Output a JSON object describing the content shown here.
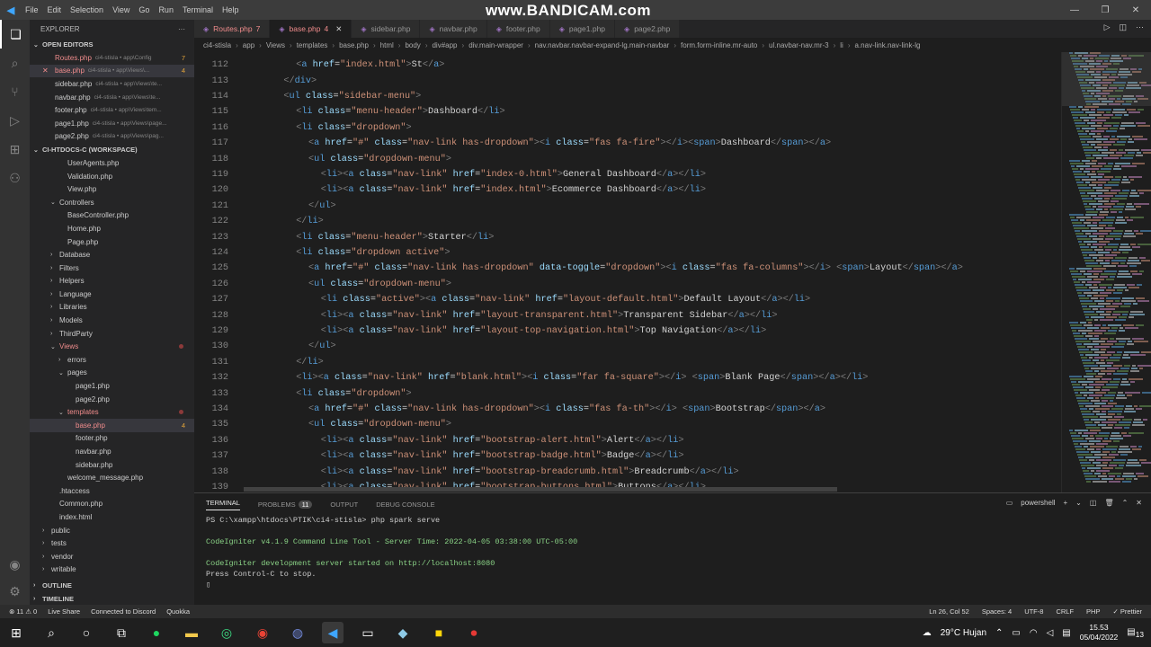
{
  "watermark": "www.BANDICAM.com",
  "menu": [
    "File",
    "Edit",
    "Selection",
    "View",
    "Go",
    "Run",
    "Terminal",
    "Help"
  ],
  "sidebar": {
    "title": "EXPLORER",
    "open_editors_label": "OPEN EDITORS",
    "open_editors": [
      {
        "name": "Routes.php",
        "desc": "ci4-stisla • app\\Config",
        "badge": "7",
        "state": "err"
      },
      {
        "name": "base.php",
        "desc": "ci4-stisla • app\\Views\\...",
        "badge": "4",
        "state": "err",
        "selected": true
      },
      {
        "name": "sidebar.php",
        "desc": "ci4-stisla • app\\Views\\te..."
      },
      {
        "name": "navbar.php",
        "desc": "ci4-stisla • app\\Views\\te..."
      },
      {
        "name": "footer.php",
        "desc": "ci4-stisla • app\\Views\\tem..."
      },
      {
        "name": "page1.php",
        "desc": "ci4-stisla • app\\Views\\page..."
      },
      {
        "name": "page2.php",
        "desc": "ci4-stisla • app\\Views\\pag..."
      }
    ],
    "workspace_label": "CI-HTDOCS-C (WORKSPACE)",
    "tree": [
      {
        "name": "UserAgents.php",
        "indent": 2
      },
      {
        "name": "Validation.php",
        "indent": 2
      },
      {
        "name": "View.php",
        "indent": 2
      },
      {
        "name": "Controllers",
        "indent": 1,
        "folder": true,
        "open": true
      },
      {
        "name": "BaseController.php",
        "indent": 2
      },
      {
        "name": "Home.php",
        "indent": 2
      },
      {
        "name": "Page.php",
        "indent": 2
      },
      {
        "name": "Database",
        "indent": 1,
        "folder": true
      },
      {
        "name": "Filters",
        "indent": 1,
        "folder": true
      },
      {
        "name": "Helpers",
        "indent": 1,
        "folder": true
      },
      {
        "name": "Language",
        "indent": 1,
        "folder": true
      },
      {
        "name": "Libraries",
        "indent": 1,
        "folder": true
      },
      {
        "name": "Models",
        "indent": 1,
        "folder": true
      },
      {
        "name": "ThirdParty",
        "indent": 1,
        "folder": true
      },
      {
        "name": "Views",
        "indent": 1,
        "folder": true,
        "open": true,
        "state": "err",
        "dot": true
      },
      {
        "name": "errors",
        "indent": 2,
        "folder": true
      },
      {
        "name": "pages",
        "indent": 2,
        "folder": true,
        "open": true
      },
      {
        "name": "page1.php",
        "indent": 3
      },
      {
        "name": "page2.php",
        "indent": 3
      },
      {
        "name": "templates",
        "indent": 2,
        "folder": true,
        "open": true,
        "state": "err",
        "dot": true
      },
      {
        "name": "base.php",
        "indent": 3,
        "state": "err",
        "badge": "4",
        "selected": true
      },
      {
        "name": "footer.php",
        "indent": 3
      },
      {
        "name": "navbar.php",
        "indent": 3
      },
      {
        "name": "sidebar.php",
        "indent": 3
      },
      {
        "name": "welcome_message.php",
        "indent": 2
      },
      {
        "name": ".htaccess",
        "indent": 1
      },
      {
        "name": "Common.php",
        "indent": 1
      },
      {
        "name": "index.html",
        "indent": 1
      },
      {
        "name": "public",
        "indent": 0,
        "folder": true
      },
      {
        "name": "tests",
        "indent": 0,
        "folder": true
      },
      {
        "name": "vendor",
        "indent": 0,
        "folder": true
      },
      {
        "name": "writable",
        "indent": 0,
        "folder": true
      }
    ],
    "outline_label": "OUTLINE",
    "timeline_label": "TIMELINE"
  },
  "tabs": [
    {
      "name": "Routes.php",
      "badge": "7",
      "state": "err"
    },
    {
      "name": "base.php",
      "badge": "4",
      "state": "active"
    },
    {
      "name": "sidebar.php"
    },
    {
      "name": "navbar.php"
    },
    {
      "name": "footer.php"
    },
    {
      "name": "page1.php"
    },
    {
      "name": "page2.php"
    }
  ],
  "breadcrumb": [
    "ci4-stisla",
    "app",
    "Views",
    "templates",
    "base.php",
    "html",
    "body",
    "div#app",
    "div.main-wrapper",
    "nav.navbar.navbar-expand-lg.main-navbar",
    "form.form-inline.mr-auto",
    "ul.navbar-nav.mr-3",
    "li",
    "a.nav-link.nav-link-lg"
  ],
  "editor": {
    "lines": [
      {
        "n": "112",
        "indent": 8,
        "html": "<a href=\"index.html\">St</a>"
      },
      {
        "n": "113",
        "indent": 6,
        "html": "</div>"
      },
      {
        "n": "114",
        "indent": 6,
        "html": "<ul class=\"sidebar-menu\">"
      },
      {
        "n": "115",
        "indent": 8,
        "html": "<li class=\"menu-header\">Dashboard</li>"
      },
      {
        "n": "116",
        "indent": 8,
        "html": "<li class=\"dropdown\">"
      },
      {
        "n": "117",
        "indent": 10,
        "html": "<a href=\"#\" class=\"nav-link has-dropdown\"><i class=\"fas fa-fire\"></i><span>Dashboard</span></a>"
      },
      {
        "n": "118",
        "indent": 10,
        "html": "<ul class=\"dropdown-menu\">"
      },
      {
        "n": "119",
        "indent": 12,
        "html": "<li><a class=\"nav-link\" href=\"index-0.html\">General Dashboard</a></li>"
      },
      {
        "n": "120",
        "indent": 12,
        "html": "<li><a class=\"nav-link\" href=\"index.html\">Ecommerce Dashboard</a></li>"
      },
      {
        "n": "121",
        "indent": 10,
        "html": "</ul>"
      },
      {
        "n": "122",
        "indent": 8,
        "html": "</li>"
      },
      {
        "n": "123",
        "indent": 8,
        "html": "<li class=\"menu-header\">Starter</li>"
      },
      {
        "n": "124",
        "indent": 8,
        "html": "<li class=\"dropdown active\">"
      },
      {
        "n": "125",
        "indent": 10,
        "html": "<a href=\"#\" class=\"nav-link has-dropdown\" data-toggle=\"dropdown\"><i class=\"fas fa-columns\"></i> <span>Layout</span></a>"
      },
      {
        "n": "126",
        "indent": 10,
        "html": "<ul class=\"dropdown-menu\">"
      },
      {
        "n": "127",
        "indent": 12,
        "html": "<li class=\"active\"><a class=\"nav-link\" href=\"layout-default.html\">Default Layout</a></li>"
      },
      {
        "n": "128",
        "indent": 12,
        "html": "<li><a class=\"nav-link\" href=\"layout-transparent.html\">Transparent Sidebar</a></li>"
      },
      {
        "n": "129",
        "indent": 12,
        "html": "<li><a class=\"nav-link\" href=\"layout-top-navigation.html\">Top Navigation</a></li>"
      },
      {
        "n": "130",
        "indent": 10,
        "html": "</ul>"
      },
      {
        "n": "131",
        "indent": 8,
        "html": "</li>"
      },
      {
        "n": "132",
        "indent": 8,
        "html": "<li><a class=\"nav-link\" href=\"blank.html\"><i class=\"far fa-square\"></i> <span>Blank Page</span></a></li>"
      },
      {
        "n": "133",
        "indent": 8,
        "html": "<li class=\"dropdown\">"
      },
      {
        "n": "134",
        "indent": 10,
        "html": "<a href=\"#\" class=\"nav-link has-dropdown\"><i class=\"fas fa-th\"></i> <span>Bootstrap</span></a>"
      },
      {
        "n": "135",
        "indent": 10,
        "html": "<ul class=\"dropdown-menu\">"
      },
      {
        "n": "136",
        "indent": 12,
        "html": "<li><a class=\"nav-link\" href=\"bootstrap-alert.html\">Alert</a></li>"
      },
      {
        "n": "137",
        "indent": 12,
        "html": "<li><a class=\"nav-link\" href=\"bootstrap-badge.html\">Badge</a></li>"
      },
      {
        "n": "138",
        "indent": 12,
        "html": "<li><a class=\"nav-link\" href=\"bootstrap-breadcrumb.html\">Breadcrumb</a></li>"
      },
      {
        "n": "139",
        "indent": 12,
        "html": "<li><a class=\"nav-link\" href=\"bootstrap-buttons.html\">Buttons</a></li>"
      }
    ]
  },
  "panel": {
    "tabs": [
      "TERMINAL",
      "PROBLEMS",
      "OUTPUT",
      "DEBUG CONSOLE"
    ],
    "problems_count": "11",
    "shell_label": "powershell",
    "terminal_lines": [
      {
        "text": "PS C:\\xampp\\htdocs\\PTIK\\ci4-stisla> php spark serve",
        "color": "white"
      },
      {
        "text": "",
        "color": "white"
      },
      {
        "text": "CodeIgniter v4.1.9 Command Line Tool - Server Time: 2022-04-05 03:38:00 UTC-05:00",
        "color": "green"
      },
      {
        "text": "",
        "color": "white"
      },
      {
        "text": "CodeIgniter development server started on http://localhost:8080",
        "color": "green"
      },
      {
        "text": "Press Control-C to stop.",
        "color": "white"
      },
      {
        "text": "▯",
        "color": "white"
      }
    ]
  },
  "status": {
    "left": [
      "⊗ 11  ⚠ 0",
      "Live Share",
      "Connected to Discord",
      "Quokka"
    ],
    "right": [
      "Ln 26, Col 52",
      "Spaces: 4",
      "UTF-8",
      "CRLF",
      "PHP",
      "✓ Prettier"
    ]
  },
  "taskbar": {
    "weather": "29°C  Hujan",
    "time": "15.53",
    "date": "05/04/2022",
    "notifications": "13"
  },
  "colors": {
    "tag": "#569cd6",
    "attr": "#9cdcfe",
    "string": "#ce9178",
    "error": "#f08c8c",
    "terminal_green": "#89d185"
  }
}
